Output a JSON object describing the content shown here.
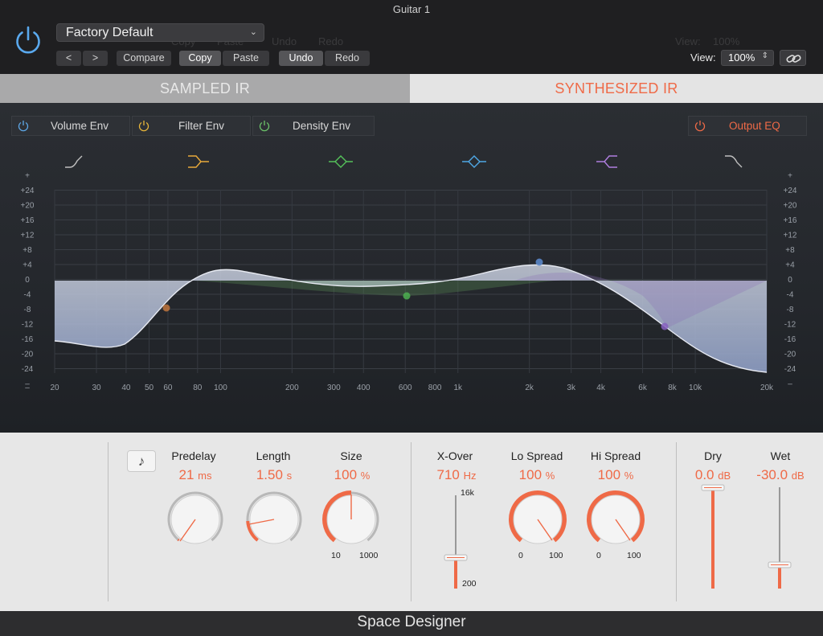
{
  "window": {
    "title": "Guitar 1"
  },
  "header": {
    "preset": "Factory Default",
    "prev_label": "<",
    "next_label": ">",
    "compare_label": "Compare",
    "copy_label": "Copy",
    "paste_label": "Paste",
    "undo_label": "Undo",
    "redo_label": "Redo",
    "view_label": "View:",
    "view_value": "100%",
    "ghost_view_label": "View:",
    "ghost_view_value": "100%",
    "ghost_copy": "Copy",
    "ghost_paste": "Paste",
    "ghost_undo": "Undo",
    "ghost_redo": "Redo"
  },
  "tabs": {
    "sampled": "SAMPLED IR",
    "synthesized": "SYNTHESIZED IR",
    "active": "synthesized"
  },
  "envelopes": [
    {
      "label": "Volume Env",
      "color": "#5ea8e8"
    },
    {
      "label": "Filter Env",
      "color": "#e8b63a"
    },
    {
      "label": "Density Env",
      "color": "#6cc36a"
    }
  ],
  "output_eq": {
    "label": "Output EQ",
    "color": "#ef6a47"
  },
  "eq": {
    "y_ticks": [
      "+",
      "+24",
      "+20",
      "+16",
      "+12",
      "+8",
      "+4",
      "0",
      "-4",
      "-8",
      "-12",
      "-16",
      "-20",
      "-24",
      "–"
    ],
    "x_ticks": [
      "20",
      "30",
      "40",
      "50",
      "60",
      "80",
      "100",
      "200",
      "300",
      "400",
      "600",
      "800",
      "1k",
      "2k",
      "3k",
      "4k",
      "6k",
      "8k",
      "10k",
      "20k"
    ],
    "band_icons": [
      "low-cut-icon",
      "low-shelf-icon",
      "bell-icon",
      "bell-icon",
      "high-shelf-icon",
      "high-cut-icon"
    ],
    "band_colors": [
      "#bfbfbf",
      "#e8a93a",
      "#55c25a",
      "#4fa8e6",
      "#b07fe0",
      "#bfbfbf"
    ]
  },
  "controls": {
    "predelay": {
      "title": "Predelay",
      "value": "21",
      "unit": "ms"
    },
    "length": {
      "title": "Length",
      "value": "1.50",
      "unit": "s"
    },
    "size": {
      "title": "Size",
      "value": "100",
      "unit": "%",
      "min": "10",
      "max": "1000"
    },
    "xover": {
      "title": "X-Over",
      "value": "710",
      "unit": "Hz",
      "max": "16k",
      "min": "200"
    },
    "lo_spread": {
      "title": "Lo Spread",
      "value": "100",
      "unit": "%",
      "min": "0",
      "max": "100"
    },
    "hi_spread": {
      "title": "Hi Spread",
      "value": "100",
      "unit": "%",
      "min": "0",
      "max": "100"
    },
    "dry": {
      "title": "Dry",
      "value": "0.0",
      "unit": "dB"
    },
    "wet": {
      "title": "Wet",
      "value": "-30.0",
      "unit": "dB"
    }
  },
  "footer": {
    "plugin_name": "Space Designer"
  },
  "colors": {
    "accent": "#ef6a47",
    "panel": "#e7e7e7"
  }
}
